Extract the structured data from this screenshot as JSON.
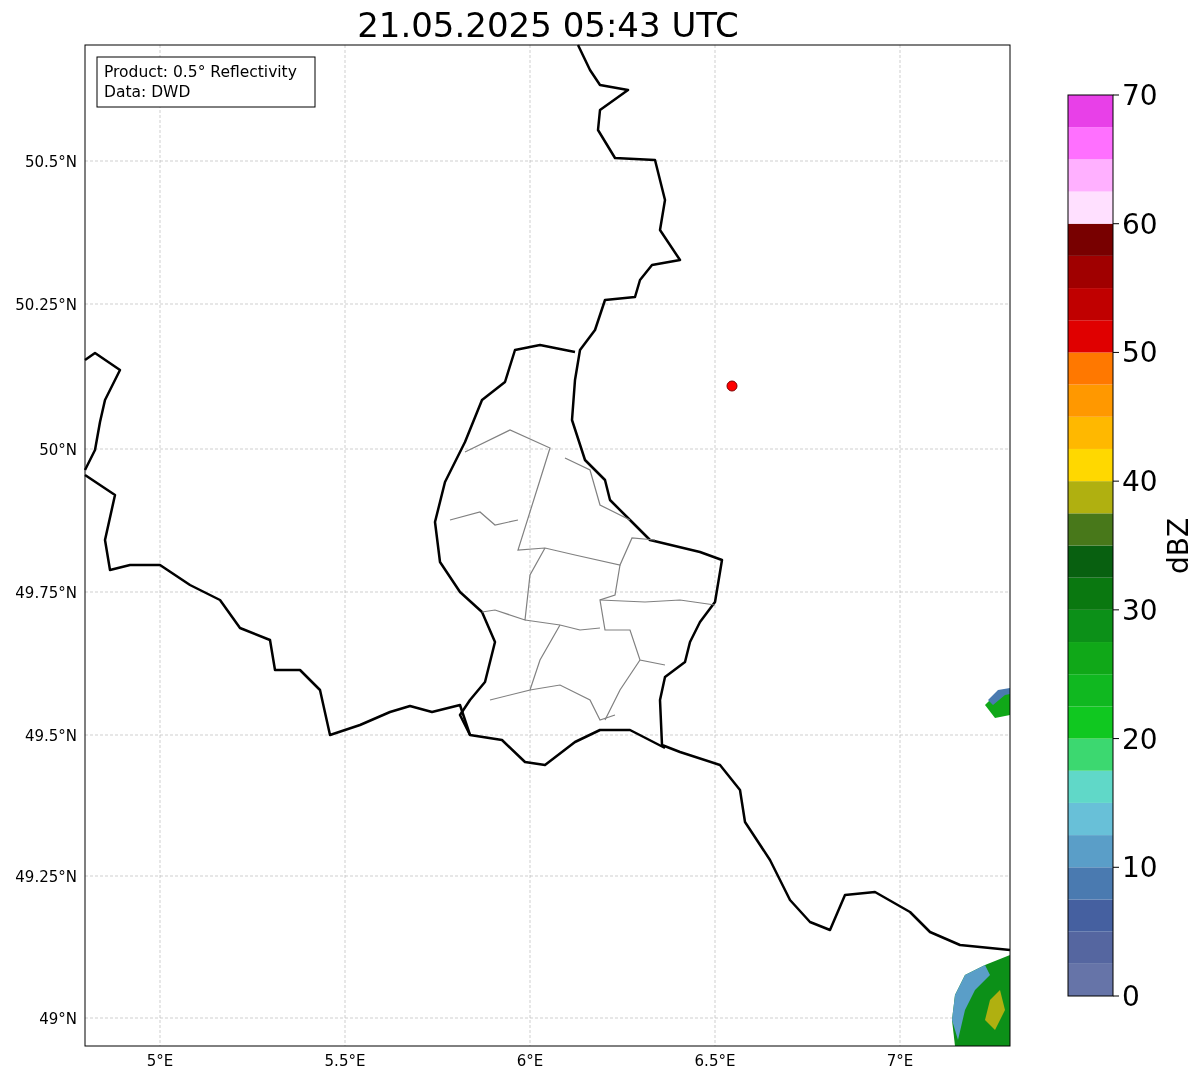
{
  "title": "21.05.2025 05:43 UTC",
  "info_box": {
    "lines": [
      "Product: 0.5° Reflectivity",
      "Data: DWD"
    ]
  },
  "map": {
    "x_ticks": [
      "5°E",
      "5.5°E",
      "6°E",
      "6.5°E",
      "7°E"
    ],
    "y_ticks": [
      "50.5°N",
      "50.25°N",
      "50°N",
      "49.75°N",
      "49.5°N",
      "49.25°N",
      "49°N"
    ]
  },
  "colorbar": {
    "label": "dBZ",
    "ticks": [
      "70",
      "60",
      "50",
      "40",
      "30",
      "20",
      "10",
      "0"
    ],
    "segments": [
      {
        "color": "#6674a8"
      },
      {
        "color": "#5566a0"
      },
      {
        "color": "#4560a0"
      },
      {
        "color": "#4a7ab0"
      },
      {
        "color": "#5a9ec8"
      },
      {
        "color": "#68c0d8"
      },
      {
        "color": "#60d8c8"
      },
      {
        "color": "#3cd870"
      },
      {
        "color": "#10c820"
      },
      {
        "color": "#10b820"
      },
      {
        "color": "#10a818"
      },
      {
        "color": "#0c9018"
      },
      {
        "color": "#0a7810"
      },
      {
        "color": "#086010"
      },
      {
        "color": "#48781a"
      },
      {
        "color": "#b0b010"
      },
      {
        "color": "#ffd800"
      },
      {
        "color": "#ffb800"
      },
      {
        "color": "#ff9800"
      },
      {
        "color": "#ff7800"
      },
      {
        "color": "#e00000"
      },
      {
        "color": "#c00000"
      },
      {
        "color": "#a00000"
      },
      {
        "color": "#780000"
      },
      {
        "color": "#ffe0ff"
      },
      {
        "color": "#ffb0ff"
      },
      {
        "color": "#ff70ff"
      },
      {
        "color": "#e840e8"
      }
    ]
  }
}
